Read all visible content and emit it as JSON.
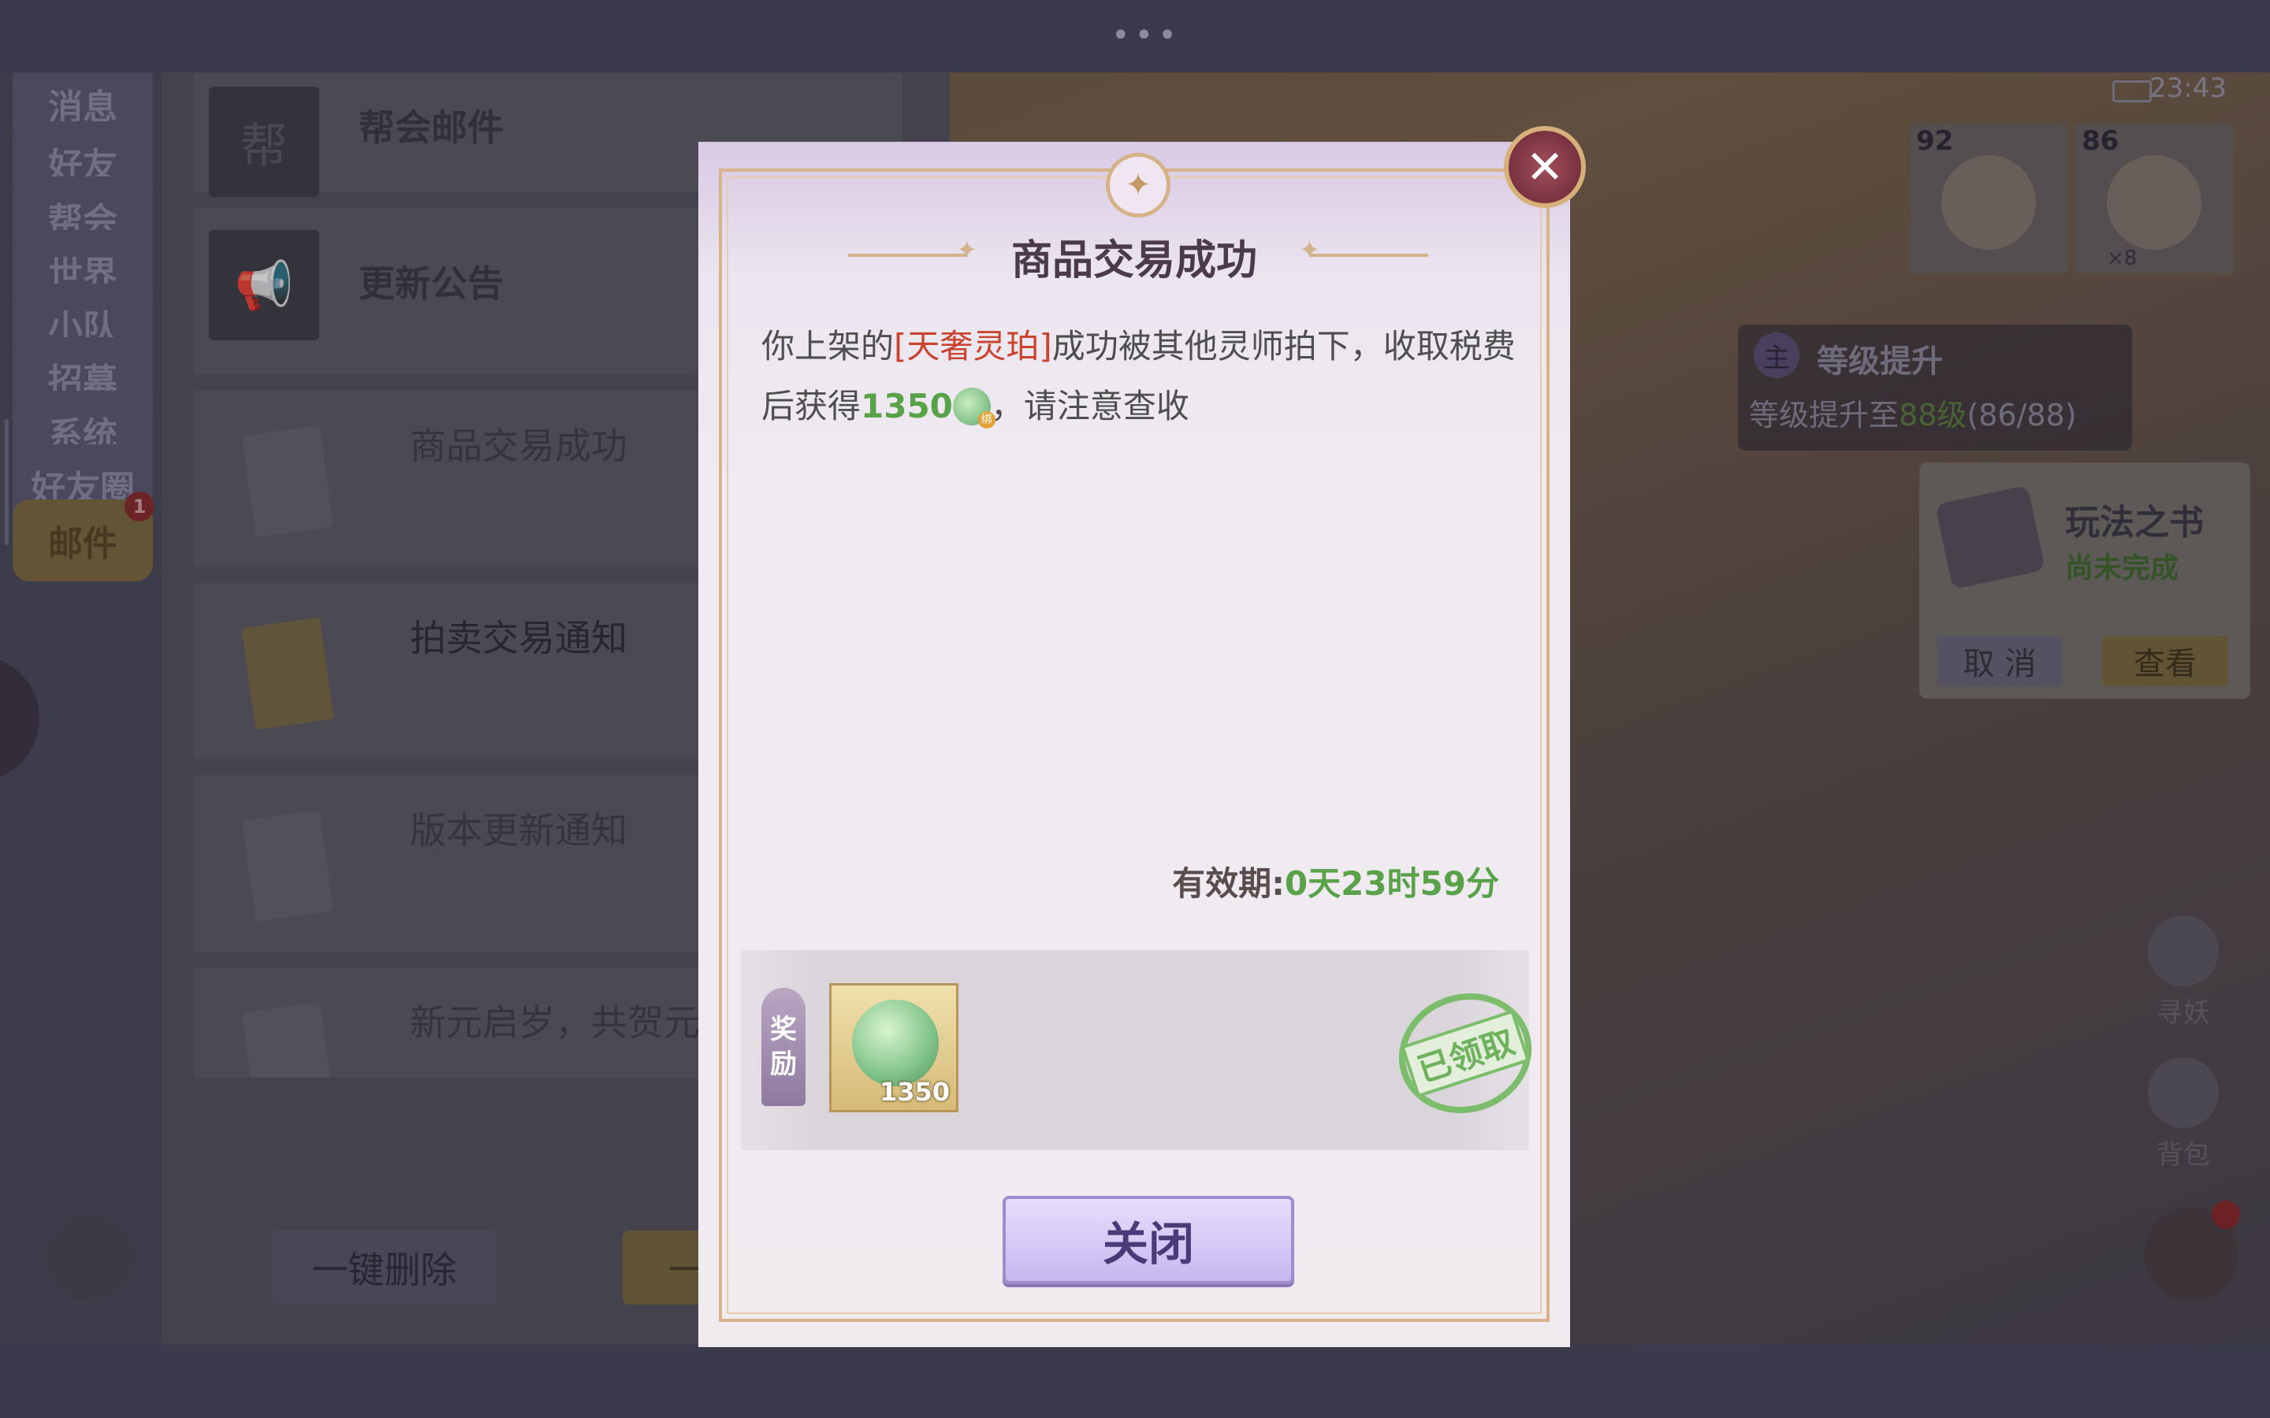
{
  "status": {
    "time": "23:43"
  },
  "sidenav": {
    "tabs": [
      "消息",
      "好友",
      "帮会",
      "世界",
      "小队",
      "招募",
      "系统",
      "好友圈",
      "邮件"
    ],
    "active_tab": "邮件",
    "mail_badge": "1"
  },
  "mails": [
    {
      "title": "帮会邮件",
      "read": false,
      "icon": "guild-scroll-icon"
    },
    {
      "title": "更新公告",
      "read": false,
      "icon": "megaphone-icon"
    },
    {
      "title": "商品交易成功",
      "read": true,
      "icon": "letter-icon"
    },
    {
      "title": "拍卖交易通知",
      "read": true,
      "icon": "envelope-icon"
    },
    {
      "title": "版本更新通知",
      "read": true,
      "icon": "letter-icon"
    },
    {
      "title": "新元启岁，共贺元旦",
      "read": true,
      "icon": "letter-icon"
    }
  ],
  "mail_footer": {
    "delete_all": "一键删除",
    "collect_all": "一键领取"
  },
  "hud": {
    "portraits": [
      {
        "level": "92"
      },
      {
        "level": "86",
        "count": "×8"
      }
    ],
    "quest": {
      "tag": "主",
      "title": "等级提升",
      "desc_prefix": "等级提升至",
      "desc_level": "88级",
      "desc_progress": "(86/88)"
    },
    "book": {
      "title": "玩法之书",
      "status": "尚未完成",
      "cancel": "取 消",
      "view": "查看"
    },
    "actions": [
      "寻妖",
      "背包"
    ]
  },
  "dialog": {
    "title": "商品交易成功",
    "message_prefix": "你上架的",
    "item_name": "[天奢灵珀]",
    "message_mid": "成功被其他灵师拍下，收取税费后获得",
    "amount": "1350",
    "message_suffix": "，请注意查收",
    "validity_label": "有效期:",
    "validity_value": "0天23时59分",
    "reward_tag_1": "奖",
    "reward_tag_2": "励",
    "reward_qty": "1350",
    "stamp_text": "已领取",
    "close_label": "关闭"
  },
  "colors": {
    "item_name": "#c9432f",
    "amount": "#5aa24a",
    "stamp": "#7bbd6a",
    "accent_gold": "#d7b28b"
  }
}
